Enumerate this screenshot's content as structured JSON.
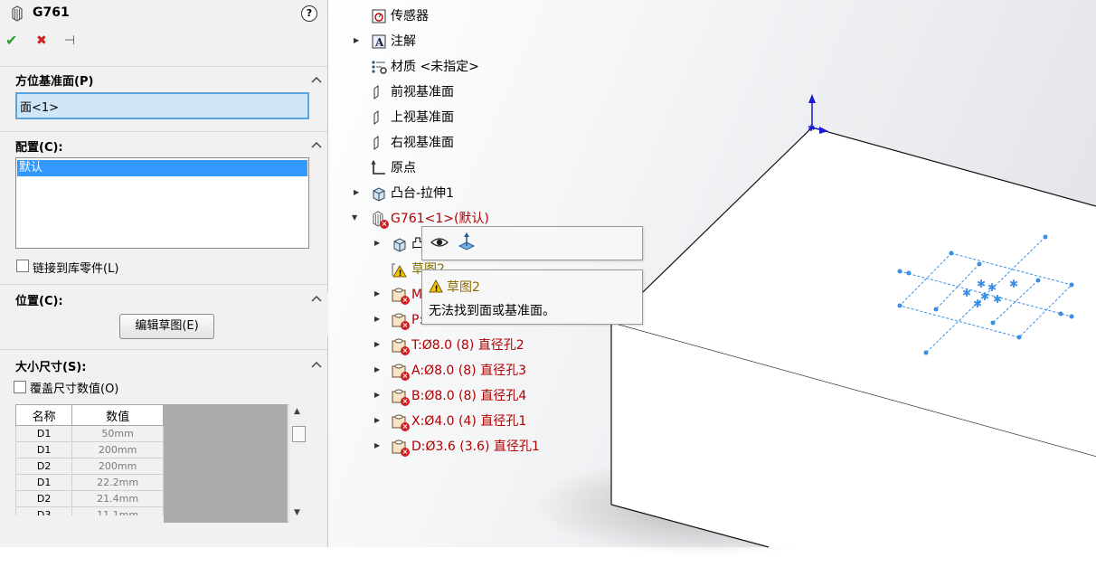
{
  "panel": {
    "title": "G761",
    "help_glyph": "?",
    "ok_glyph": "✔",
    "cancel_glyph": "✖",
    "pin_glyph": "⊣",
    "orient_section": {
      "title": "方位基准面(P)",
      "value": "面<1>"
    },
    "config_section": {
      "title": "配置(C):",
      "selected": "默认",
      "link_label": "链接到库零件(L)"
    },
    "position_section": {
      "title": "位置(C):",
      "edit_button": "编辑草图(E)"
    },
    "size_section": {
      "title": "大小尺寸(S):",
      "override_label": "覆盖尺寸数值(O)",
      "columns": [
        "名称",
        "数值"
      ],
      "rows": [
        {
          "name": "D1",
          "value": "50mm"
        },
        {
          "name": "D1",
          "value": "200mm"
        },
        {
          "name": "D2",
          "value": "200mm"
        },
        {
          "name": "D1",
          "value": "22.2mm"
        },
        {
          "name": "D2",
          "value": "21.4mm"
        },
        {
          "name": "D3",
          "value": "11.1mm"
        }
      ]
    }
  },
  "tree": {
    "items": [
      {
        "label": "传感器",
        "icon": "sensor-icon"
      },
      {
        "label": "注解",
        "icon": "annotation-icon"
      },
      {
        "label": "材质 <未指定>",
        "icon": "material-icon"
      },
      {
        "label": "前视基准面",
        "icon": "plane-icon"
      },
      {
        "label": "上视基准面",
        "icon": "plane-icon"
      },
      {
        "label": "右视基准面",
        "icon": "plane-icon"
      },
      {
        "label": "原点",
        "icon": "origin-icon"
      },
      {
        "label": "凸台-拉伸1",
        "icon": "extrude-icon"
      },
      {
        "label": "G761<1>(默认)",
        "icon": "library-feature-error-icon"
      }
    ],
    "children": [
      {
        "label": "凸",
        "icon": "extrude-icon"
      },
      {
        "label": "草图2",
        "icon": "sketch-warning-icon"
      },
      {
        "label": "M",
        "icon": "hole-error-icon"
      },
      {
        "label": "P:",
        "suffix": "直径孔2",
        "icon": "hole-error-icon"
      },
      {
        "label": "T:Ø8.0 (8) 直径孔2",
        "icon": "hole-error-icon"
      },
      {
        "label": "A:Ø8.0 (8) 直径孔3",
        "icon": "hole-error-icon"
      },
      {
        "label": "B:Ø8.0 (8) 直径孔4",
        "icon": "hole-error-icon"
      },
      {
        "label": "X:Ø4.0 (4) 直径孔1",
        "icon": "hole-error-icon"
      },
      {
        "label": "D:Ø3.6 (3.6) 直径孔1",
        "icon": "hole-error-icon"
      }
    ]
  },
  "context_toolbar": {
    "icons": [
      "eye-icon",
      "plane-normal-icon"
    ]
  },
  "tooltip": {
    "title": "草图2",
    "message": "无法找到面或基准面。"
  },
  "colors": {
    "error_text": "#b00000",
    "warning_text": "#8a6d00",
    "selection": "#cfe5f8",
    "sketch": "#3a8ee6"
  }
}
